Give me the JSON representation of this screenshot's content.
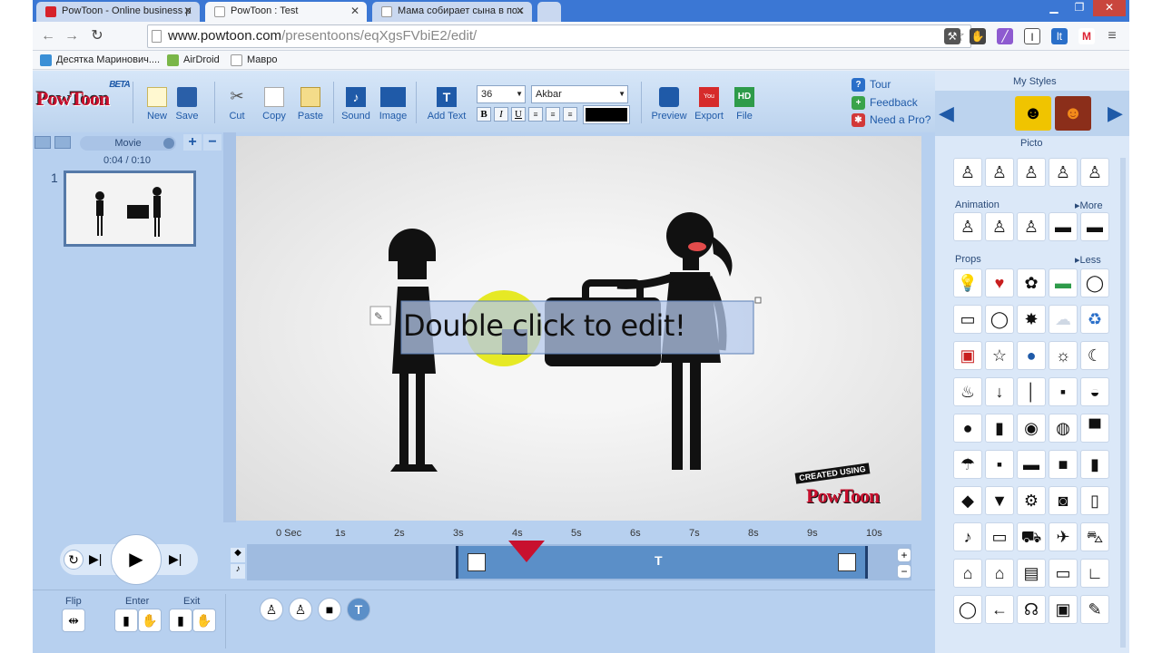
{
  "browser": {
    "tabs": [
      {
        "title": "PowToon - Online business p",
        "active": false
      },
      {
        "title": "PowToon : Test",
        "active": true
      },
      {
        "title": "Мама собирает сына в пох",
        "active": false
      }
    ],
    "url_host": "www.powtoon.com",
    "url_path": "/presentoons/eqXgsFVbiE2/edit/",
    "bookmarks": [
      "Десятка Маринович....",
      "AirDroid",
      "Мавро"
    ]
  },
  "app": {
    "logo": "PowToon",
    "logo_badge": "BETA",
    "toolbar": {
      "new": "New",
      "save": "Save",
      "cut": "Cut",
      "copy": "Copy",
      "paste": "Paste",
      "sound": "Sound",
      "image": "Image",
      "add_text": "Add Text",
      "font_size": "36",
      "font_name": "Akbar",
      "bold": "B",
      "italic": "I",
      "underline": "U",
      "preview": "Preview",
      "export": "Export",
      "file": "File",
      "hd": "HD"
    },
    "help": {
      "tour": "Tour",
      "feedback": "Feedback",
      "need_pro": "Need a Pro?"
    },
    "left_panel": {
      "mode": "Movie",
      "time": "0:04 / 0:10",
      "slide_number": "1"
    },
    "stage": {
      "text_box": "Double click to edit!",
      "watermark_top": "CREATED USING",
      "watermark_logo": "PowToon"
    },
    "right_panel": {
      "title": "My Styles",
      "style_name": "Picto",
      "animation_label": "Animation",
      "more_label": "More",
      "props_label": "Props",
      "less_label": "Less"
    },
    "timeline": {
      "ticks": [
        "0 Sec",
        "1s",
        "2s",
        "3s",
        "4s",
        "5s",
        "6s",
        "7s",
        "8s",
        "9s",
        "10s"
      ],
      "playhead_seconds": 4,
      "text_marker": "T"
    },
    "bottom": {
      "flip": "Flip",
      "enter": "Enter",
      "exit": "Exit"
    }
  }
}
